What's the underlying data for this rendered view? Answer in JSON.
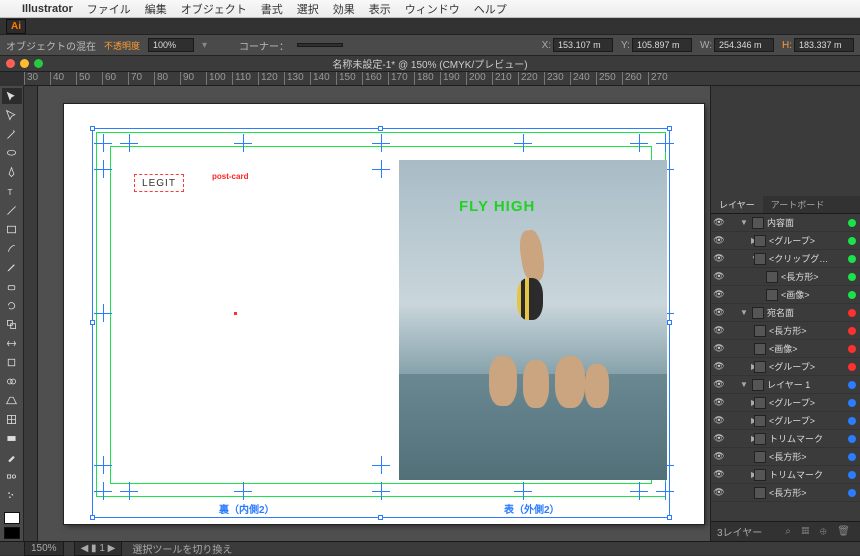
{
  "menubar": {
    "app": "Illustrator",
    "items": [
      "ファイル",
      "編集",
      "オブジェクト",
      "書式",
      "選択",
      "効果",
      "表示",
      "ウィンドウ",
      "ヘルプ"
    ]
  },
  "options": {
    "label": "オブジェクトの混在",
    "opacity_label": "不透明度",
    "opacity_value": "100%",
    "corner_label": "コーナー：",
    "x": "153.107 m",
    "y": "105.897 m",
    "w": "254.346 m",
    "h": "183.337 m"
  },
  "doc": {
    "title": "名称未設定-1* @ 150% (CMYK/プレビュー)"
  },
  "ruler_ticks": [
    "30",
    "40",
    "50",
    "60",
    "70",
    "80",
    "90",
    "100",
    "110",
    "120",
    "130",
    "140",
    "150",
    "160",
    "170",
    "180",
    "190",
    "200",
    "210",
    "220",
    "230",
    "240",
    "250",
    "260",
    "270"
  ],
  "artboard": {
    "logo": "LEGIT",
    "small_red": "post-card",
    "fly": "FLY HIGH",
    "caption_left": "裏（内側2）",
    "caption_right": "表（外側2）"
  },
  "panels": {
    "tabs": [
      "レイヤー",
      "アートボード"
    ],
    "layers": [
      {
        "d": 0,
        "name": "内容面",
        "arrow": "▼",
        "color": "#19e24a"
      },
      {
        "d": 1,
        "name": "<グループ>",
        "arrow": "▶",
        "color": "#19e24a"
      },
      {
        "d": 1,
        "name": "<クリップグ…",
        "arrow": "▼",
        "color": "#19e24a"
      },
      {
        "d": 2,
        "name": "<長方形>",
        "arrow": "",
        "color": "#19e24a"
      },
      {
        "d": 2,
        "name": "<画像>",
        "arrow": "",
        "color": "#19e24a"
      },
      {
        "d": 0,
        "name": "宛名面",
        "arrow": "▼",
        "color": "#ff3030"
      },
      {
        "d": 1,
        "name": "<長方形>",
        "arrow": "",
        "color": "#ff3030"
      },
      {
        "d": 1,
        "name": "<画像>",
        "arrow": "",
        "color": "#ff3030"
      },
      {
        "d": 1,
        "name": "<グループ>",
        "arrow": "▶",
        "color": "#ff3030"
      },
      {
        "d": 0,
        "name": "レイヤー 1",
        "arrow": "▼",
        "color": "#2b7cff"
      },
      {
        "d": 1,
        "name": "<グループ>",
        "arrow": "▶",
        "color": "#2b7cff"
      },
      {
        "d": 1,
        "name": "<グループ>",
        "arrow": "▶",
        "color": "#2b7cff"
      },
      {
        "d": 1,
        "name": "トリムマーク",
        "arrow": "▶",
        "color": "#2b7cff"
      },
      {
        "d": 1,
        "name": "<長方形>",
        "arrow": "",
        "color": "#2b7cff"
      },
      {
        "d": 1,
        "name": "トリムマーク",
        "arrow": "▶",
        "color": "#2b7cff"
      },
      {
        "d": 1,
        "name": "<長方形>",
        "arrow": "",
        "color": "#2b7cff"
      }
    ],
    "footer": "3レイヤー"
  },
  "status": {
    "zoom": "150%",
    "tool": "選択ツールを切り換え"
  }
}
